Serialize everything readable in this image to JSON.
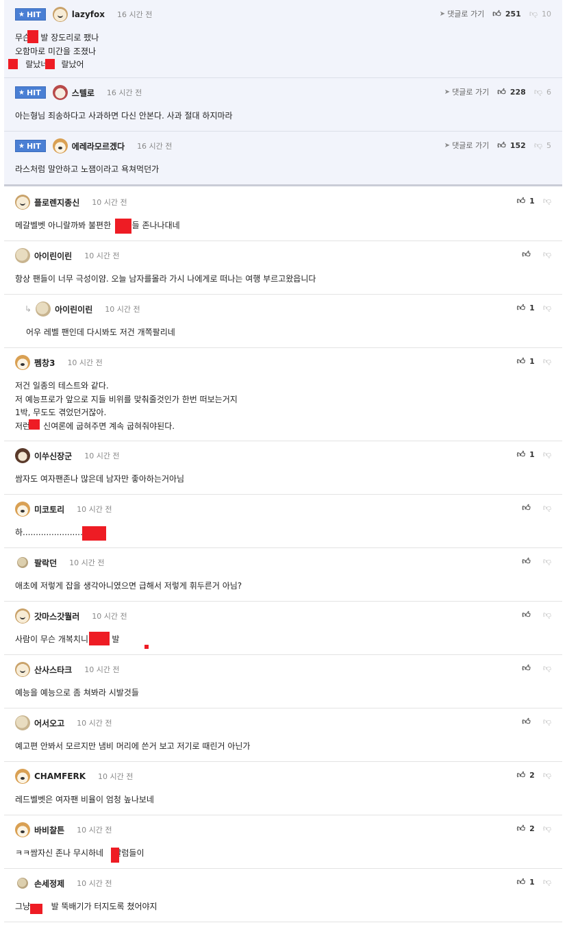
{
  "hit_label": "HIT",
  "goto_label": "댓글로 가기",
  "hit_comments": [
    {
      "name": "lazyfox",
      "time": "16 시간 전",
      "likes": "251",
      "dislikes": "10",
      "body": "무슨    발 장도리로 팼나\n오함마로 미간을 조졌나\n    랄났네     랄났어"
    },
    {
      "name": "스텔로",
      "time": "16 시간 전",
      "likes": "228",
      "dislikes": "6",
      "body": "아는형님 죄송하다고 사과하면 다신 안본다. 사과 절대 하지마라"
    },
    {
      "name": "에레라모르겠다",
      "time": "16 시간 전",
      "likes": "152",
      "dislikes": "5",
      "body": "라스처럼 말안하고 노잼이라고 욕쳐먹던가"
    }
  ],
  "comments": [
    {
      "name": "플로렌지종신",
      "time": "10 시간 전",
      "likes": "1",
      "body": "메갈벨벳 아니랄까봐 불편한        들 존나나대네"
    },
    {
      "name": "아이린이린",
      "time": "10 시간 전",
      "likes": "",
      "body": "항상 팬들이 너무 극성이얌. 오늘 남자를몰라 가시 나에게로 떠나는 여행 부르고왔읍니다"
    },
    {
      "name": "아이린이린",
      "time": "10 시간 전",
      "likes": "1",
      "body": "어우 레벨 팬인데 다시봐도 저건 개쪽팔리네"
    },
    {
      "name": "펨창3",
      "time": "10 시간 전",
      "likes": "1",
      "body": "저건 일종의 테스트와 같다.\n저 예능프로가 앞으로 지들 비위를 맞춰줄것인가 한번 떠보는거지\n1박, 무도도 겪었던거잖아.\n저런     신여론에 굽혀주면 계속 굽혀줘야된다."
    },
    {
      "name": "이쑤신장군",
      "time": "10 시간 전",
      "likes": "1",
      "body": "쌈자도 여자팬존나 많은데 남자만 좋아하는거아님"
    },
    {
      "name": "미코토리",
      "time": "10 시간 전",
      "likes": "",
      "body": "하........................"
    },
    {
      "name": "팔락던",
      "time": "10 시간 전",
      "likes": "",
      "body": "애초에 저렇게 잡을 생각아니였으면 급해서 저렇게 휘두른거 아님?"
    },
    {
      "name": "갓마스갓뭘러",
      "time": "10 시간 전",
      "likes": "",
      "body": "사람이 무슨 개복치니         발"
    },
    {
      "name": "산사스타크",
      "time": "10 시간 전",
      "likes": "",
      "body": "예능을 예능으로 좀 쳐봐라 시발것들"
    },
    {
      "name": "어서오고",
      "time": "10 시간 전",
      "likes": "",
      "body": "예고편 안봐서 모르지만 냄비 머리에 쓴거 보고 저기로 때린거 아닌가"
    },
    {
      "name": "CHAMFERK",
      "time": "10 시간 전",
      "likes": "2",
      "body": "레드벨벳은 여자팬 비율이 엄청 높나보네"
    },
    {
      "name": "바비찰튼",
      "time": "10 시간 전",
      "likes": "2",
      "body": "ㅋㅋ쌈자신 존나 무시하네    발럼들이"
    },
    {
      "name": "손세정제",
      "time": "10 시간 전",
      "likes": "1",
      "body": "그냥        발 뚝배기가 터지도록 쳤어야지"
    }
  ],
  "icons": {
    "star": "star-icon",
    "goto": "arrow-icon",
    "like": "thumbs-up-icon",
    "dislike": "thumbs-down-icon",
    "reply": "reply-arrow-icon",
    "censor": "red-censor-block"
  },
  "colors": {
    "hit_bg": "#f2f4fb",
    "badge": "#4a7fd4",
    "censor": "#ee1c24"
  }
}
